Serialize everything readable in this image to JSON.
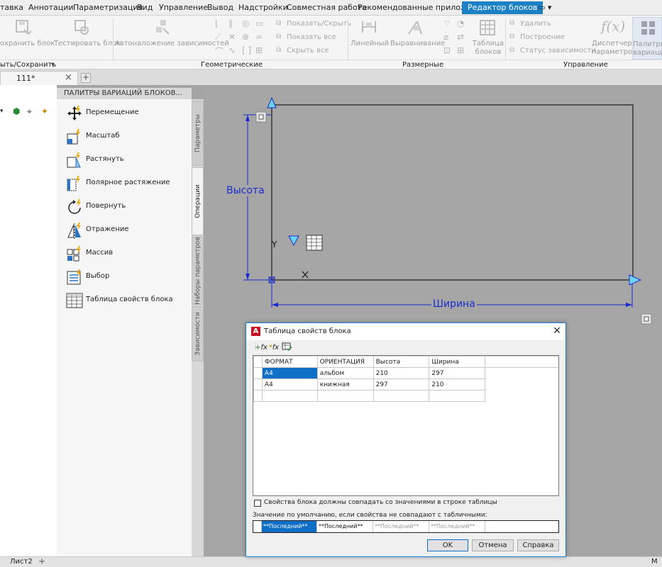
{
  "ribbon_tabs": [
    "тавка",
    "Аннотации",
    "Параметризация",
    "Вид",
    "Управление",
    "Вывод",
    "Надстройки",
    "Совместная работа",
    "Рекомендованные приложения",
    "Редактор блоков"
  ],
  "ribbon_tab_dropdown": "▭ ▾",
  "ribbon": {
    "save_block": "охранить блок",
    "test_block": "Тестировать блок",
    "auto_constraints": "Автоналожение зависимостей",
    "show_hide": "Показать/Скрыть",
    "show_all": "Показать все",
    "hide_all": "Скрыть все",
    "linear": "Линейный",
    "align": "Выравнивание",
    "table_line1": "Таблица",
    "table_line2": "блоков",
    "delete": "Удалить",
    "construct": "Построение",
    "constraint_status": "Статус зависимости",
    "dispatcher_line1": "Диспетчер",
    "dispatcher_line2": "параметров",
    "palettes_line1": "Палитры",
    "palettes_line2": "вариаци",
    "panel_open_save": "ыть/Сохранить",
    "panel_geometric": "Геометрические",
    "panel_dimensional": "Размерные",
    "panel_manage": "Управление"
  },
  "doc_tab": {
    "name": "111*",
    "close": "×",
    "add": "+"
  },
  "palette": {
    "title": "ПАЛИТРЫ ВАРИАЦИЙ БЛОКОВ...",
    "items": [
      "Перемещение",
      "Масштаб",
      "Растянуть",
      "Полярное растяжение",
      "Повернуть",
      "Отражение",
      "Массив",
      "Выбор",
      "Таблица свойств блока"
    ],
    "side_tabs": [
      "Параметры",
      "Операции",
      "Наборы параметров",
      "Зависимости"
    ]
  },
  "drawing": {
    "height_label": "Высота",
    "width_label": "Ширина",
    "axis_y": "Y",
    "axis_x": "X"
  },
  "dialog": {
    "title": "Таблица свойств блока",
    "close": "✕",
    "headers": [
      "ФОРМАТ",
      "ОРИЕНТАЦИЯ",
      "Высота",
      "Ширина"
    ],
    "rows": [
      [
        "A4",
        "альбом",
        "210",
        "297"
      ],
      [
        "A4",
        "книжная",
        "297",
        "210"
      ]
    ],
    "checkbox_label": "Свойства блока должны совпадать со значениями в строке таблицы",
    "default_label": "Значение по умолчанию, если свойства не совпадают с табличными:",
    "defaults": [
      "**Последний**",
      "**Последний**",
      "**Последний**",
      "**Последний**"
    ],
    "ok": "OK",
    "cancel": "Отмена",
    "help": "Справка"
  },
  "bottom": {
    "layout_tab": "Лист2",
    "add": "+",
    "corner": "М"
  },
  "colors": {
    "accent": "#1b80c4",
    "selection": "#0f6fc6",
    "dimension": "#1a2bd0"
  }
}
